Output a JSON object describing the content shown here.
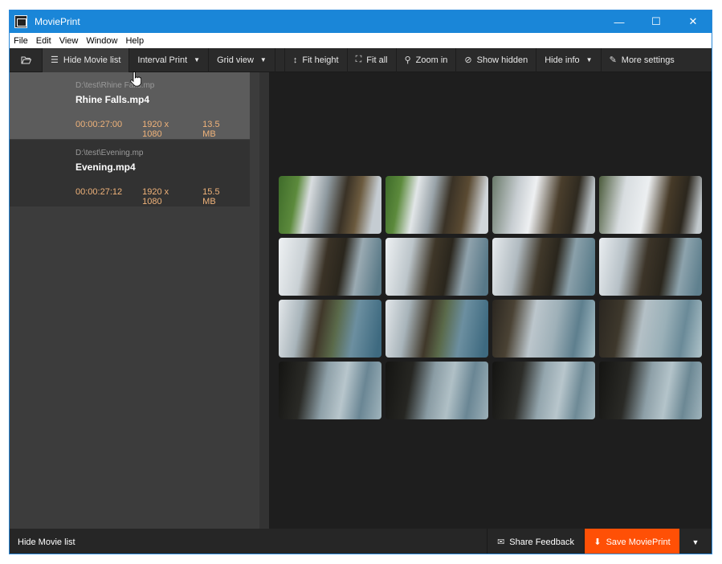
{
  "window": {
    "title": "MoviePrint",
    "controls": [
      "minimize",
      "maximize",
      "close"
    ]
  },
  "menu": {
    "items": [
      "File",
      "Edit",
      "View",
      "Window",
      "Help"
    ]
  },
  "toolbar": {
    "open_icon": "folder-open-icon",
    "hide_movie_list": "Hide Movie list",
    "interval_print": "Interval Print",
    "grid_view": "Grid view",
    "fit_height": "Fit height",
    "fit_all": "Fit all",
    "zoom_in": "Zoom in",
    "show_hidden": "Show hidden",
    "hide_info": "Hide info",
    "more_settings": "More settings"
  },
  "movies": [
    {
      "path": "D:\\test\\Rhine Falls.mp",
      "name": "Rhine Falls.mp4",
      "duration": "00:00:27:00",
      "resolution": "1920 x 1080",
      "size": "13.5 MB",
      "selected": true
    },
    {
      "path": "D:\\test\\Evening.mp",
      "name": "Evening.mp4",
      "duration": "00:00:27:12",
      "resolution": "1920 x 1080",
      "size": "15.5 MB",
      "selected": false
    }
  ],
  "thumbnails": {
    "columns": 4,
    "rows": 4,
    "count": 16
  },
  "statusbar": {
    "hide_movie_list": "Hide Movie list",
    "share_feedback": "Share Feedback",
    "save_movieprint": "Save MoviePrint"
  },
  "colors": {
    "accent": "#ff5006",
    "titlebar": "#1a86d8",
    "meta_text": "#f0b37a"
  }
}
